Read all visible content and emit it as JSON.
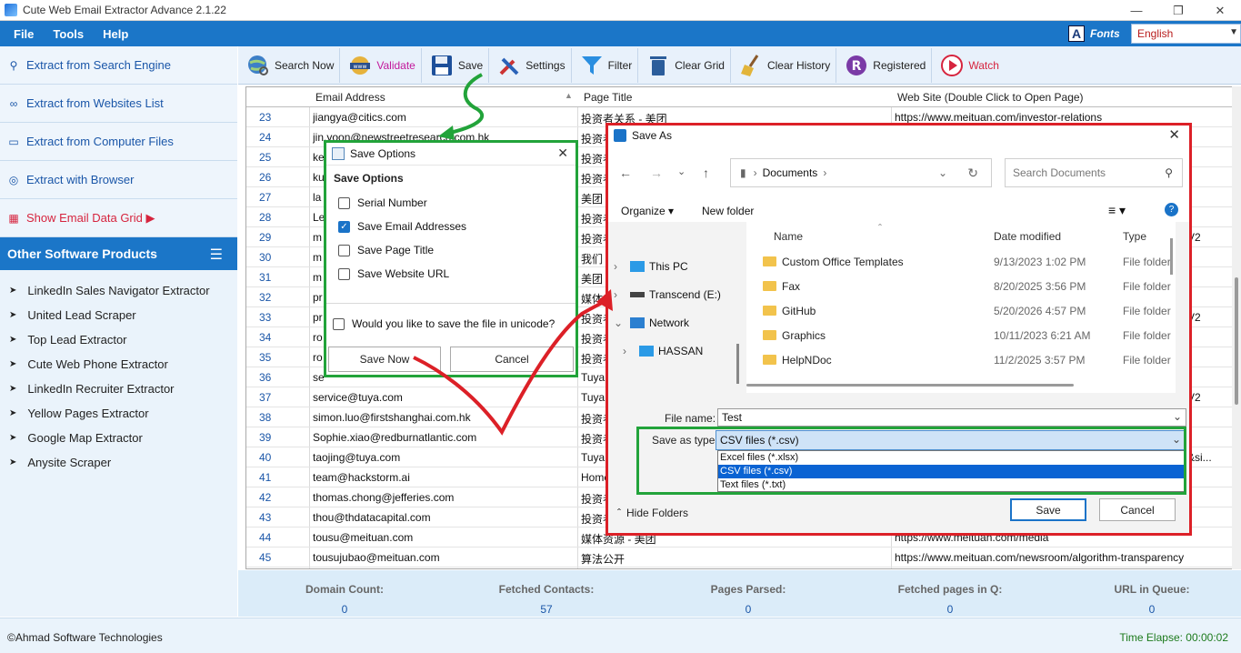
{
  "window": {
    "title": "Cute Web Email Extractor Advance 2.1.22"
  },
  "menu": [
    "File",
    "Tools",
    "Help"
  ],
  "fonts_label": "Fonts",
  "language": "English",
  "sidebar": {
    "buttons": [
      {
        "label": "Extract from Search Engine",
        "icon": "search-icon"
      },
      {
        "label": "Extract from Websites List",
        "icon": "link-icon"
      },
      {
        "label": "Extract from Computer Files",
        "icon": "computer-icon"
      },
      {
        "label": "Extract with Browser",
        "icon": "globe-icon"
      },
      {
        "label": "Show Email Data Grid ▶",
        "icon": "grid-icon"
      }
    ],
    "other_title": "Other Software Products",
    "products": [
      "LinkedIn Sales Navigator Extractor",
      "United Lead Scraper",
      "Top Lead Extractor",
      "Cute Web Phone Extractor",
      "LinkedIn Recruiter Extractor",
      "Yellow Pages Extractor",
      "Google Map Extractor",
      "Anysite Scraper"
    ]
  },
  "toolbar": [
    {
      "label": "Search Now",
      "icon": "globe-search-icon"
    },
    {
      "label": "Validate",
      "icon": "www-icon"
    },
    {
      "label": "Save",
      "icon": "floppy-icon"
    },
    {
      "label": "Settings",
      "icon": "tools-icon"
    },
    {
      "label": "Filter",
      "icon": "funnel-icon"
    },
    {
      "label": "Clear Grid",
      "icon": "trash-icon"
    },
    {
      "label": "Clear History",
      "icon": "broom-icon"
    },
    {
      "label": "Registered",
      "icon": "registered-icon"
    },
    {
      "label": "Watch",
      "icon": "play-icon"
    }
  ],
  "colors": {
    "accent": "#1b76c8",
    "validate": "#c2189b",
    "watch": "#d6243e",
    "highlight_green": "#22a33a",
    "highlight_red": "#dc2027"
  },
  "grid": {
    "columns": [
      "Email Address",
      "Page Title",
      "Web Site (Double Click to Open Page)"
    ],
    "rows": [
      {
        "n": "23",
        "email": "jiangya@citics.com",
        "title": "投资者关系 - 美团",
        "site": "https://www.meituan.com/investor-relations"
      },
      {
        "n": "24",
        "email": "jin.yoon@newstreetresearch.com.hk",
        "title": "投资者",
        "site": ""
      },
      {
        "n": "25",
        "email": "ke",
        "title": "投资者",
        "site": ""
      },
      {
        "n": "26",
        "email": "ku",
        "title": "投资者",
        "site": ""
      },
      {
        "n": "27",
        "email": "la",
        "title": "美团",
        "site": ""
      },
      {
        "n": "28",
        "email": "Le",
        "title": "投资者",
        "site": ""
      },
      {
        "n": "29",
        "email": "m",
        "title": "投资者",
        "site": "V2"
      },
      {
        "n": "30",
        "email": "m",
        "title": "我们",
        "site": ""
      },
      {
        "n": "31",
        "email": "m",
        "title": "美团",
        "site": ""
      },
      {
        "n": "32",
        "email": "pr",
        "title": "媒体",
        "site": ""
      },
      {
        "n": "33",
        "email": "pr",
        "title": "投资者",
        "site": "V2"
      },
      {
        "n": "34",
        "email": "ro",
        "title": "投资者",
        "site": ""
      },
      {
        "n": "35",
        "email": "ro",
        "title": "投资者",
        "site": ""
      },
      {
        "n": "36",
        "email": "se",
        "title": "Tuya",
        "site": ""
      },
      {
        "n": "37",
        "email": "service@tuya.com",
        "title": "Tuya",
        "site": "V2"
      },
      {
        "n": "38",
        "email": "simon.luo@firstshanghai.com.hk",
        "title": "投资者",
        "site": ""
      },
      {
        "n": "39",
        "email": "Sophie.xiao@redburnatlantic.com",
        "title": "投资者",
        "site": ""
      },
      {
        "n": "40",
        "email": "taojing@tuya.com",
        "title": "Tuya",
        "site": "&si..."
      },
      {
        "n": "41",
        "email": "team@hackstorm.ai",
        "title": "Home",
        "site": ""
      },
      {
        "n": "42",
        "email": "thomas.chong@jefferies.com",
        "title": "投资者",
        "site": ""
      },
      {
        "n": "43",
        "email": "thou@thdatacapital.com",
        "title": "投资者",
        "site": ""
      },
      {
        "n": "44",
        "email": "tousu@meituan.com",
        "title": "媒体资源 - 美团",
        "site": "https://www.meituan.com/media"
      },
      {
        "n": "45",
        "email": "tousujubao@meituan.com",
        "title": "算法公开",
        "site": "https://www.meituan.com/newsroom/algorithm-transparency"
      }
    ]
  },
  "status": [
    {
      "label": "Domain Count:",
      "value": "0"
    },
    {
      "label": "Fetched Contacts:",
      "value": "57"
    },
    {
      "label": "Pages Parsed:",
      "value": "0"
    },
    {
      "label": "Fetched pages in Q:",
      "value": "0"
    },
    {
      "label": "URL in Queue:",
      "value": "0"
    }
  ],
  "footer": {
    "copyright": "©Ahmad Software Technologies",
    "time": "Time Elapse: 00:00:02"
  },
  "save_options": {
    "title": "Save Options",
    "group": "Save Options",
    "options": [
      {
        "label": "Serial Number",
        "checked": false
      },
      {
        "label": "Save Email Addresses",
        "checked": true
      },
      {
        "label": "Save Page Title",
        "checked": false
      },
      {
        "label": "Save Website URL",
        "checked": false
      }
    ],
    "unicode_label": "Would you like to save the file in unicode?",
    "save_now": "Save Now",
    "cancel": "Cancel"
  },
  "save_as": {
    "title": "Save As",
    "path": "Documents",
    "search_placeholder": "Search Documents",
    "organize": "Organize",
    "new_folder": "New folder",
    "tree": [
      "This PC",
      "Transcend (E:)",
      "Network",
      "HASSAN"
    ],
    "file_columns": [
      "Name",
      "Date modified",
      "Type"
    ],
    "files": [
      {
        "name": "Custom Office Templates",
        "date": "9/13/2023 1:02 PM",
        "type": "File folder"
      },
      {
        "name": "Fax",
        "date": "8/20/2025 3:56 PM",
        "type": "File folder"
      },
      {
        "name": "GitHub",
        "date": "5/20/2026 4:57 PM",
        "type": "File folder"
      },
      {
        "name": "Graphics",
        "date": "10/11/2023 6:21 AM",
        "type": "File folder"
      },
      {
        "name": "HelpNDoc",
        "date": "11/2/2025 3:57 PM",
        "type": "File folder"
      }
    ],
    "filename_label": "File name:",
    "filename": "Test",
    "savetype_label": "Save as type:",
    "savetype": "CSV files (*.csv)",
    "type_options": [
      "Excel files (*.xlsx)",
      "CSV files (*.csv)",
      "Text files (*.txt)"
    ],
    "hide_folders": "Hide Folders",
    "save": "Save",
    "cancel": "Cancel"
  }
}
